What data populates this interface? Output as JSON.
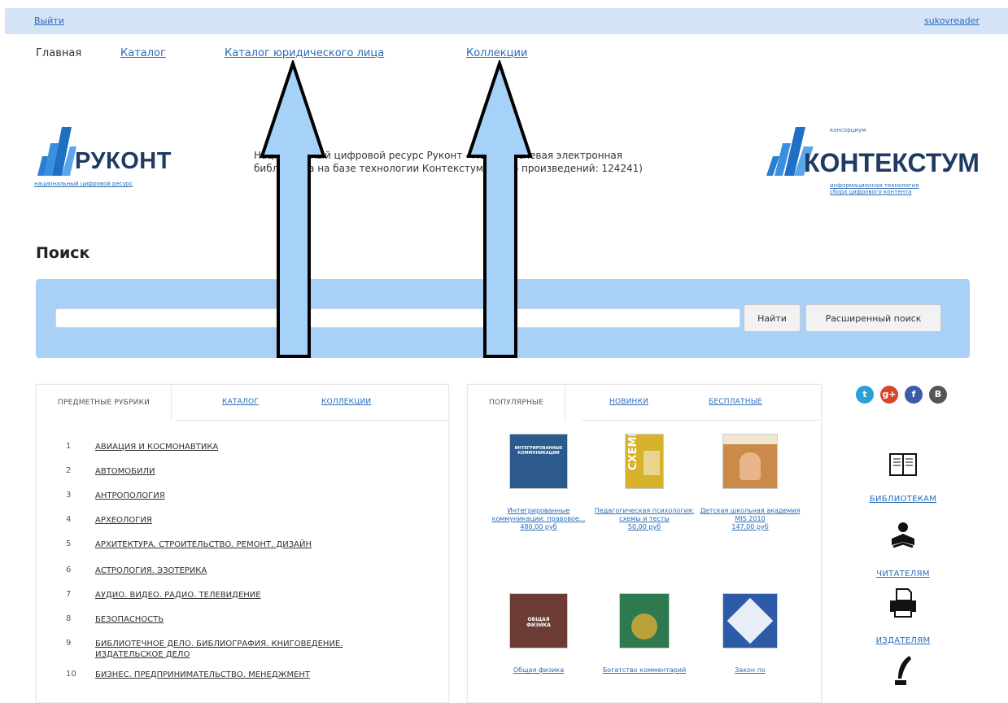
{
  "topbar": {
    "logout": "Выйти",
    "user": "sukovreader"
  },
  "nav": [
    {
      "label": "Главная"
    },
    {
      "label": "Каталог"
    },
    {
      "label": "Каталог юридического лица"
    },
    {
      "label": "Коллекции"
    }
  ],
  "logo_left": {
    "name": "РУКОНТ",
    "tagline": "национальный цифровой ресурс"
  },
  "about": {
    "line1": "Национальный цифровой ресурс Руконт - межотраслевая электронная",
    "line2": "библиотека на базе технологии Контекстум (всего произведений: 124241)"
  },
  "logo_right": {
    "pre": "консорциум",
    "name": "КОНТЕКСТУМ",
    "tagline1": "информационная технология",
    "tagline2": "сбора цифрового контента"
  },
  "search": {
    "title": "Поиск",
    "placeholder": "",
    "find_label": "Найти",
    "advanced_label": "Расширенный поиск"
  },
  "left_tabs": [
    {
      "label": "ПРЕДМЕТНЫЕ РУБРИКИ"
    },
    {
      "label": "КАТАЛОГ"
    },
    {
      "label": "КОЛЛЕКЦИИ"
    }
  ],
  "rubrics": [
    {
      "num": "1",
      "label": "АВИАЦИЯ И КОСМОНАВТИКА"
    },
    {
      "num": "2",
      "label": "АВТОМОБИЛИ"
    },
    {
      "num": "3",
      "label": "АНТРОПОЛОГИЯ"
    },
    {
      "num": "4",
      "label": "АРХЕОЛОГИЯ"
    },
    {
      "num": "5",
      "label": "АРХИТЕКТУРА. СТРОИТЕЛЬСТВО. РЕМОНТ. ДИЗАЙН"
    },
    {
      "num": "6",
      "label": "АСТРОЛОГИЯ. ЭЗОТЕРИКА"
    },
    {
      "num": "7",
      "label": "АУДИО. ВИДЕО. РАДИО. ТЕЛЕВИДЕНИЕ"
    },
    {
      "num": "8",
      "label": "БЕЗОПАСНОСТЬ"
    },
    {
      "num": "9",
      "label": "БИБЛИОТЕЧНОЕ ДЕЛО. БИБЛИОГРАФИЯ. КНИГОВЕДЕНИЕ. ИЗДАТЕЛЬСКОЕ ДЕЛО"
    },
    {
      "num": "10",
      "label": "БИЗНЕС. ПРЕДПРИНИМАТЕЛЬСТВО. МЕНЕДЖМЕНТ"
    }
  ],
  "mid_tabs": [
    {
      "label": "ПОПУЛЯРНЫЕ"
    },
    {
      "label": "НОВИНКИ"
    },
    {
      "label": "БЕСПЛАТНЫЕ"
    }
  ],
  "books": [
    {
      "title": "Интегрированные коммуникации: правовое...",
      "price": "480,00 руб",
      "cover_color": "#2c5a8c",
      "cover_text": "ИНТЕГРИРОВАННЫЕ КОММУНИКАЦИИ"
    },
    {
      "title": "Педагогическая психология: схемы и тесты",
      "price": "50,00 руб",
      "cover_color": "#d7b22a",
      "cover_text": "СХЕМЫ"
    },
    {
      "title": "Детская школьная академия MIS 2010",
      "price": "147,00 руб",
      "cover_color": "#c98a4a",
      "cover_text": ""
    },
    {
      "title": "Общая физика",
      "price": "",
      "cover_color": "#6b3b34",
      "cover_text": "ОБЩАЯ ФИЗИКА"
    },
    {
      "title": "Богатство комментарий",
      "price": "",
      "cover_color": "#2e7a4f",
      "cover_text": ""
    },
    {
      "title": "Закон по",
      "price": "",
      "cover_color": "#2d5ba8",
      "cover_text": ""
    }
  ],
  "social": [
    {
      "icon": "twitter-icon",
      "glyph": "t",
      "color": "#2a9fd8"
    },
    {
      "icon": "googleplus-icon",
      "glyph": "g+",
      "color": "#d9452c"
    },
    {
      "icon": "facebook-icon",
      "glyph": "f",
      "color": "#3b5ca8"
    },
    {
      "icon": "vk-icon",
      "glyph": "В",
      "color": "#555555"
    }
  ],
  "side_links": [
    {
      "label": "БИБЛИОТЕКАМ",
      "icon": "book-icon"
    },
    {
      "label": "ЧИТАТЕЛЯМ",
      "icon": "reader-icon"
    },
    {
      "label": "ИЗДАТЕЛЯМ",
      "icon": "printer-icon"
    },
    {
      "label": "",
      "icon": "quill-icon"
    }
  ],
  "colors": {
    "arrow_fill": "#a6d1f8",
    "arrow_stroke": "#000000",
    "search_panel": "#a9d0f6",
    "topbar": "#d5e3f7"
  }
}
